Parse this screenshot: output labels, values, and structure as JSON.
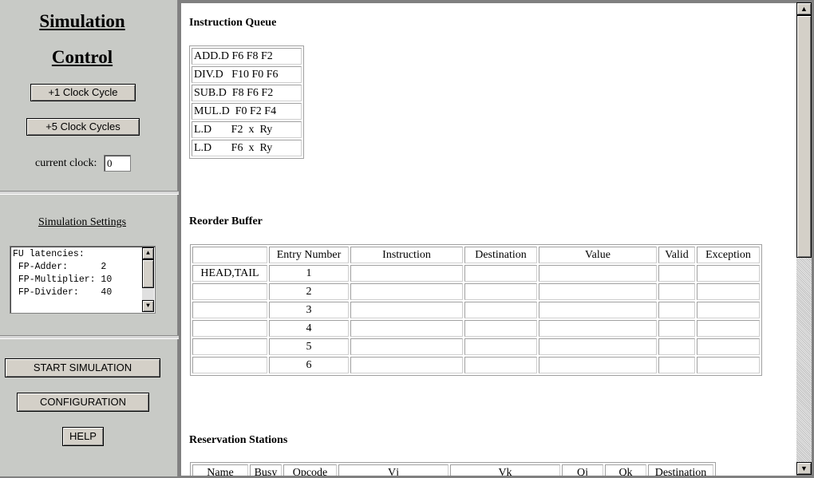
{
  "control": {
    "title_line1": "Simulation",
    "title_line2": "Control",
    "clock1_label": "+1 Clock Cycle",
    "clock5_label": "+5 Clock Cycles",
    "current_clock_label": "current clock:",
    "current_clock_value": "0"
  },
  "settings": {
    "link_label": "Simulation Settings",
    "latencies_text": "FU latencies:\n FP-Adder:      2\n FP-Multiplier: 10\n FP-Divider:    40"
  },
  "actions": {
    "start_label": "START SIMULATION",
    "config_label": "CONFIGURATION",
    "help_label": "HELP"
  },
  "instruction_queue": {
    "heading": "Instruction Queue",
    "items": [
      "ADD.D F6 F8 F2",
      "DIV.D   F10 F0 F6",
      "SUB.D  F8 F6 F2",
      "MUL.D  F0 F2 F4",
      "L.D       F2  x  Ry",
      "L.D       F6  x  Ry"
    ]
  },
  "reorder_buffer": {
    "heading": "Reorder Buffer",
    "columns": [
      "",
      "Entry Number",
      "Instruction",
      "Destination",
      "Value",
      "Valid",
      "Exception"
    ],
    "rows": [
      [
        "HEAD,TAIL",
        "1",
        "",
        "",
        "",
        "",
        ""
      ],
      [
        "",
        "2",
        "",
        "",
        "",
        "",
        ""
      ],
      [
        "",
        "3",
        "",
        "",
        "",
        "",
        ""
      ],
      [
        "",
        "4",
        "",
        "",
        "",
        "",
        ""
      ],
      [
        "",
        "5",
        "",
        "",
        "",
        "",
        ""
      ],
      [
        "",
        "6",
        "",
        "",
        "",
        "",
        ""
      ]
    ]
  },
  "reservation_stations": {
    "heading": "Reservation Stations",
    "columns": [
      "Name",
      "Busy",
      "Opcode",
      "Vj",
      "Vk",
      "Qj",
      "Qk",
      "Destination"
    ]
  },
  "icons": {
    "scroll_up": "up-arrow-icon",
    "scroll_down": "down-arrow-icon"
  }
}
